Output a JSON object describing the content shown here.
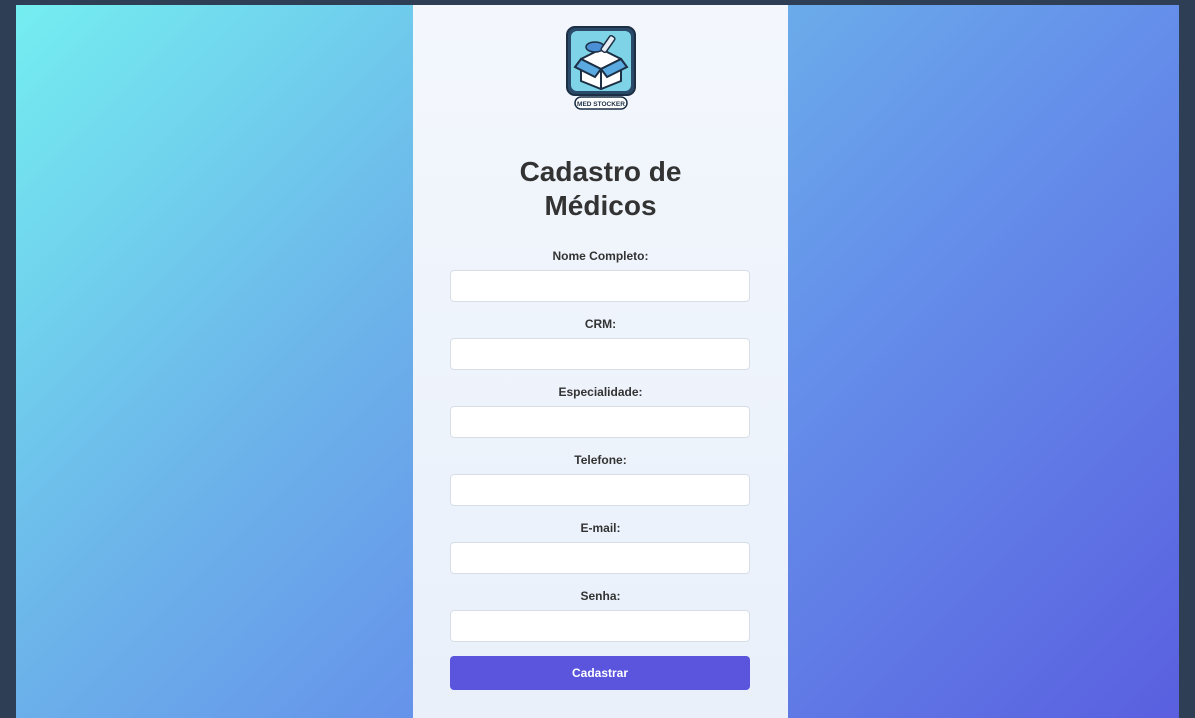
{
  "form": {
    "title_line1": "Cadastro de",
    "title_line2": "Médicos",
    "logo_text": "MED STOCKER",
    "fields": [
      {
        "label": "Nome Completo:",
        "value": "",
        "placeholder": ""
      },
      {
        "label": "CRM:",
        "value": "",
        "placeholder": ""
      },
      {
        "label": "Especialidade:",
        "value": "",
        "placeholder": ""
      },
      {
        "label": "Telefone:",
        "value": "",
        "placeholder": ""
      },
      {
        "label": "E-mail:",
        "value": "",
        "placeholder": ""
      },
      {
        "label": "Senha:",
        "value": "",
        "placeholder": ""
      }
    ],
    "submit_label": "Cadastrar"
  },
  "colors": {
    "page_background": "#2e3f55",
    "gradient_start": "#74eef0",
    "gradient_end": "#5a5fe0",
    "card_background": "#f0f5fc",
    "button": "#5a55dc",
    "title_text": "#333333"
  },
  "icons": {
    "logo": "med-stocker-box-logo"
  }
}
